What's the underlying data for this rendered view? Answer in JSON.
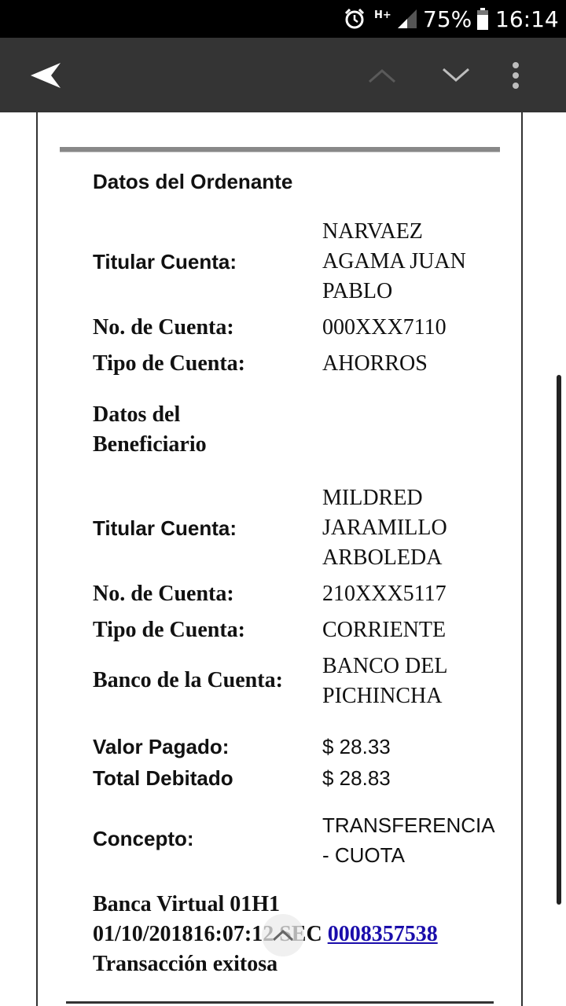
{
  "status_bar": {
    "alarm_icon": "alarm-clock-icon",
    "network": "H+",
    "battery": "75%",
    "time": "16:14"
  },
  "toolbar": {
    "back_icon": "back-arrow-icon",
    "up_icon": "chevron-up-icon",
    "down_icon": "chevron-down-icon",
    "more_icon": "more-vert-icon"
  },
  "ordenante": {
    "heading": "Datos del Ordenante",
    "titular_label": "Titular Cuenta:",
    "titular_value": [
      "NARVAEZ",
      "AGAMA JUAN",
      "PABLO"
    ],
    "cuenta_label": "No. de Cuenta:",
    "cuenta_value": "000XXX7110",
    "tipo_label": "Tipo de Cuenta:",
    "tipo_value": "AHORROS"
  },
  "beneficiario": {
    "heading": [
      "Datos del",
      "Beneficiario"
    ],
    "titular_label": "Titular Cuenta:",
    "titular_value": [
      "MILDRED",
      "JARAMILLO",
      "ARBOLEDA"
    ],
    "cuenta_label": "No. de Cuenta:",
    "cuenta_value": "210XXX5117",
    "tipo_label": "Tipo de Cuenta:",
    "tipo_value": "CORRIENTE",
    "banco_label": "Banco de la Cuenta:",
    "banco_value": [
      "BANCO DEL",
      "PICHINCHA"
    ]
  },
  "pago": {
    "valor_label": "Valor Pagado:",
    "valor_value": "$ 28.33",
    "total_label": "Total Debitado",
    "total_value": "$ 28.83",
    "concepto_label": "Concepto:",
    "concepto_value": [
      "TRANSFERENCIA",
      "- CUOTA"
    ]
  },
  "footer": {
    "line1": "Banca Virtual 01H1",
    "line2_prefix": "01/10/201816:07:12 SEC ",
    "line2_link": "0008357538",
    "line3": "Transacción exitosa"
  },
  "colors": {
    "status_bar": "#000000",
    "toolbar": "#343434",
    "link": "#1a0dab"
  }
}
